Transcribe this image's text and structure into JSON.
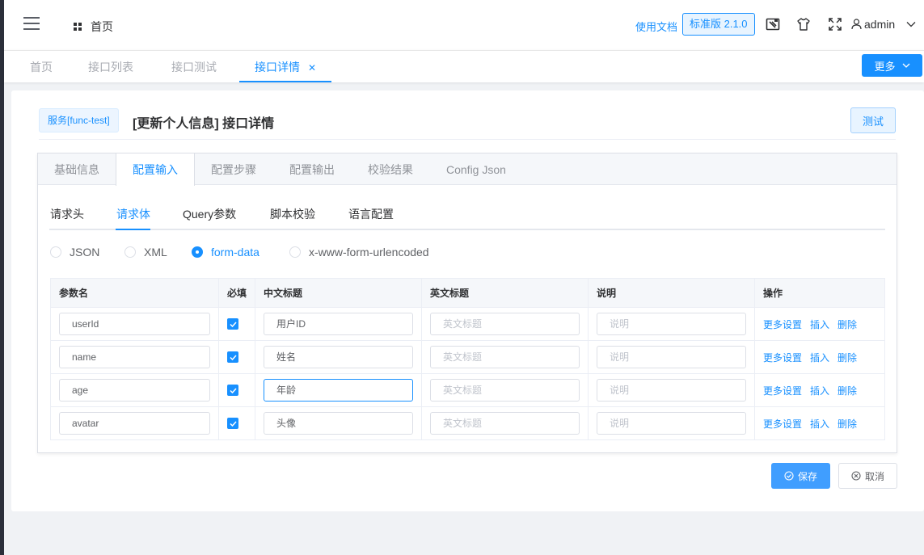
{
  "header": {
    "breadcrumb": "首页",
    "docs_link": "使用文档",
    "version_badge": "标准版 2.1.0",
    "username": "admin"
  },
  "tags_view": {
    "tags": [
      "首页",
      "接口列表",
      "接口测试",
      "接口详情"
    ],
    "active_index": 3,
    "more_label": "更多"
  },
  "page": {
    "service_tag": "服务[func-test]",
    "title": "[更新个人信息] 接口详情",
    "test_button": "测试"
  },
  "main_tabs": {
    "items": [
      "基础信息",
      "配置输入",
      "配置步骤",
      "配置输出",
      "校验结果",
      "Config Json"
    ],
    "active_index": 1
  },
  "sub_tabs": {
    "items": [
      "请求头",
      "请求体",
      "Query参数",
      "脚本校验",
      "语言配置"
    ],
    "active_index": 1
  },
  "body_type": {
    "options": [
      "JSON",
      "XML",
      "form-data",
      "x-www-form-urlencoded"
    ],
    "selected": "form-data"
  },
  "params_table": {
    "columns": [
      "参数名",
      "必填",
      "中文标题",
      "英文标题",
      "说明",
      "操作"
    ],
    "placeholders": {
      "en_title": "英文标题",
      "desc": "说明"
    },
    "actions": [
      "更多设置",
      "插入",
      "删除"
    ],
    "rows": [
      {
        "name": "userId",
        "required": true,
        "cn_title": "用户ID",
        "en_title": "",
        "desc": ""
      },
      {
        "name": "name",
        "required": true,
        "cn_title": "姓名",
        "en_title": "",
        "desc": ""
      },
      {
        "name": "age",
        "required": true,
        "cn_title": "年龄",
        "en_title": "",
        "desc": ""
      },
      {
        "name": "avatar",
        "required": true,
        "cn_title": "头像",
        "en_title": "",
        "desc": ""
      }
    ]
  },
  "footer": {
    "save_label": "保存",
    "cancel_label": "取消"
  },
  "colors": {
    "primary": "#1890ff",
    "sidebar": "#2b2f3a"
  }
}
